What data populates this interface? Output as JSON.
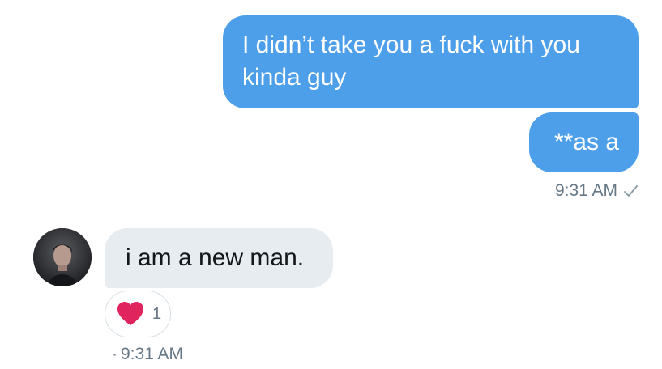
{
  "messages": {
    "sent": [
      {
        "text": "I didn’t take you a fuck with you kinda guy"
      },
      {
        "text": "**as a"
      }
    ],
    "sent_time": "9:31 AM",
    "received": {
      "text": "i am a new man.",
      "reaction_count": "1",
      "time": "9:31 AM"
    }
  },
  "colors": {
    "outgoing_bubble": "#4d9fea",
    "incoming_bubble": "#e6ecf0",
    "heart": "#e0245e",
    "meta_text": "#657786"
  },
  "icons": {
    "status": "check-icon",
    "reaction": "heart-icon",
    "avatar": "avatar"
  }
}
